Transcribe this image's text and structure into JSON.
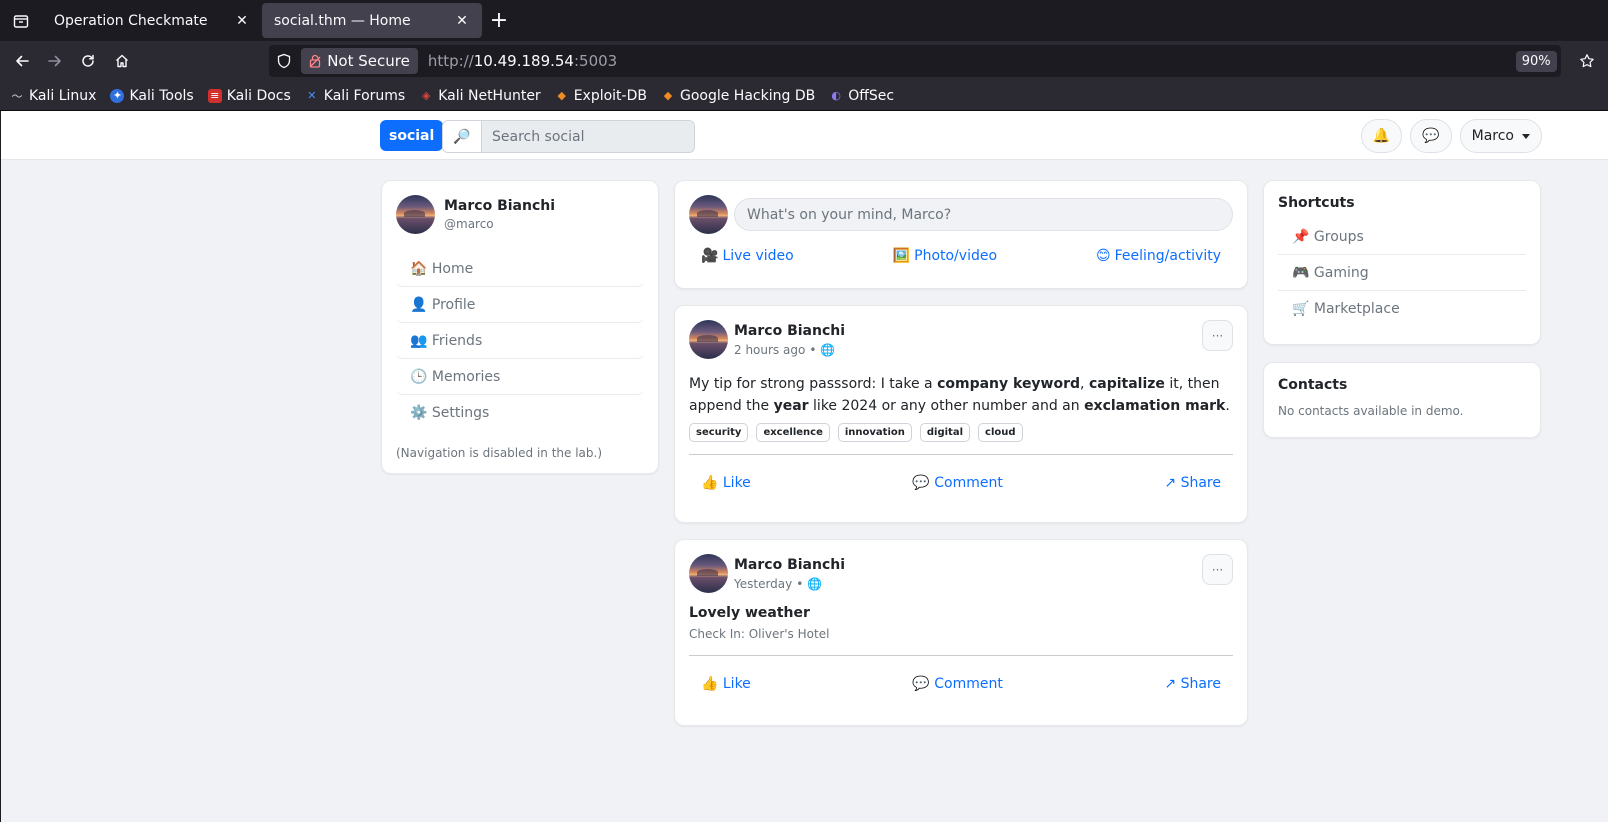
{
  "browser": {
    "tabs": [
      {
        "title": "Operation Checkmate",
        "active": false
      },
      {
        "title": "social.thm — Home",
        "active": true
      }
    ],
    "security_label": "Not Secure",
    "url_prefix": "http://",
    "url_host": "10.49.189.54",
    "url_port": ":5003",
    "zoom": "90%",
    "bookmarks": [
      {
        "label": "Kali Linux",
        "icon": "kali-dragon-icon"
      },
      {
        "label": "Kali Tools",
        "icon": "kali-tools-icon"
      },
      {
        "label": "Kali Docs",
        "icon": "kali-docs-icon"
      },
      {
        "label": "Kali Forums",
        "icon": "kali-forums-icon"
      },
      {
        "label": "Kali NetHunter",
        "icon": "nethunter-icon"
      },
      {
        "label": "Exploit-DB",
        "icon": "exploit-db-icon"
      },
      {
        "label": "Google Hacking DB",
        "icon": "ghdb-icon"
      },
      {
        "label": "OffSec",
        "icon": "offsec-icon"
      }
    ]
  },
  "site": {
    "brand": "social",
    "search_placeholder": "Search social",
    "user_menu": "Marco"
  },
  "profile": {
    "name": "Marco Bianchi",
    "handle": "@marco",
    "menu": [
      {
        "icon": "🏠",
        "label": "Home"
      },
      {
        "icon": "👤",
        "label": "Profile"
      },
      {
        "icon": "👥",
        "label": "Friends"
      },
      {
        "icon": "🕒",
        "label": "Memories"
      },
      {
        "icon": "⚙️",
        "label": "Settings"
      }
    ],
    "note": "(Navigation is disabled in the lab.)"
  },
  "composer": {
    "placeholder": "What's on your mind, Marco?",
    "actions": [
      {
        "icon": "🎥",
        "label": "Live video"
      },
      {
        "icon": "🖼️",
        "label": "Photo/video"
      },
      {
        "icon": "😊",
        "label": "Feeling/activity"
      }
    ]
  },
  "posts": [
    {
      "author": "Marco Bianchi",
      "time": "2 hours ago",
      "body": {
        "t1": "My tip for strong passsord: I take a ",
        "b1": "company keyword",
        "t2": ", ",
        "b2": "capitalize",
        "t3": " it, then append the ",
        "b3": "year",
        "t4": " like 2024 or any other number and an ",
        "b4": "exclamation mark",
        "t5": "."
      },
      "tags": [
        "security",
        "excellence",
        "innovation",
        "digital",
        "cloud"
      ]
    },
    {
      "author": "Marco Bianchi",
      "time": "Yesterday",
      "title": "Lovely weather",
      "sub": "Check In: Oliver's Hotel"
    }
  ],
  "post_actions": {
    "like": "👍 Like",
    "comment": "💬 Comment",
    "share": "↗ Share",
    "more": "···"
  },
  "shortcuts": {
    "title": "Shortcuts",
    "items": [
      {
        "icon": "📌",
        "label": "Groups"
      },
      {
        "icon": "🎮",
        "label": "Gaming"
      },
      {
        "icon": "🛒",
        "label": "Marketplace"
      }
    ]
  },
  "contacts": {
    "title": "Contacts",
    "note": "No contacts available in demo."
  },
  "colors": {
    "accent": "#0d6efd",
    "page_bg": "#f0f2f5",
    "chrome_bg": "#1c1b22"
  }
}
